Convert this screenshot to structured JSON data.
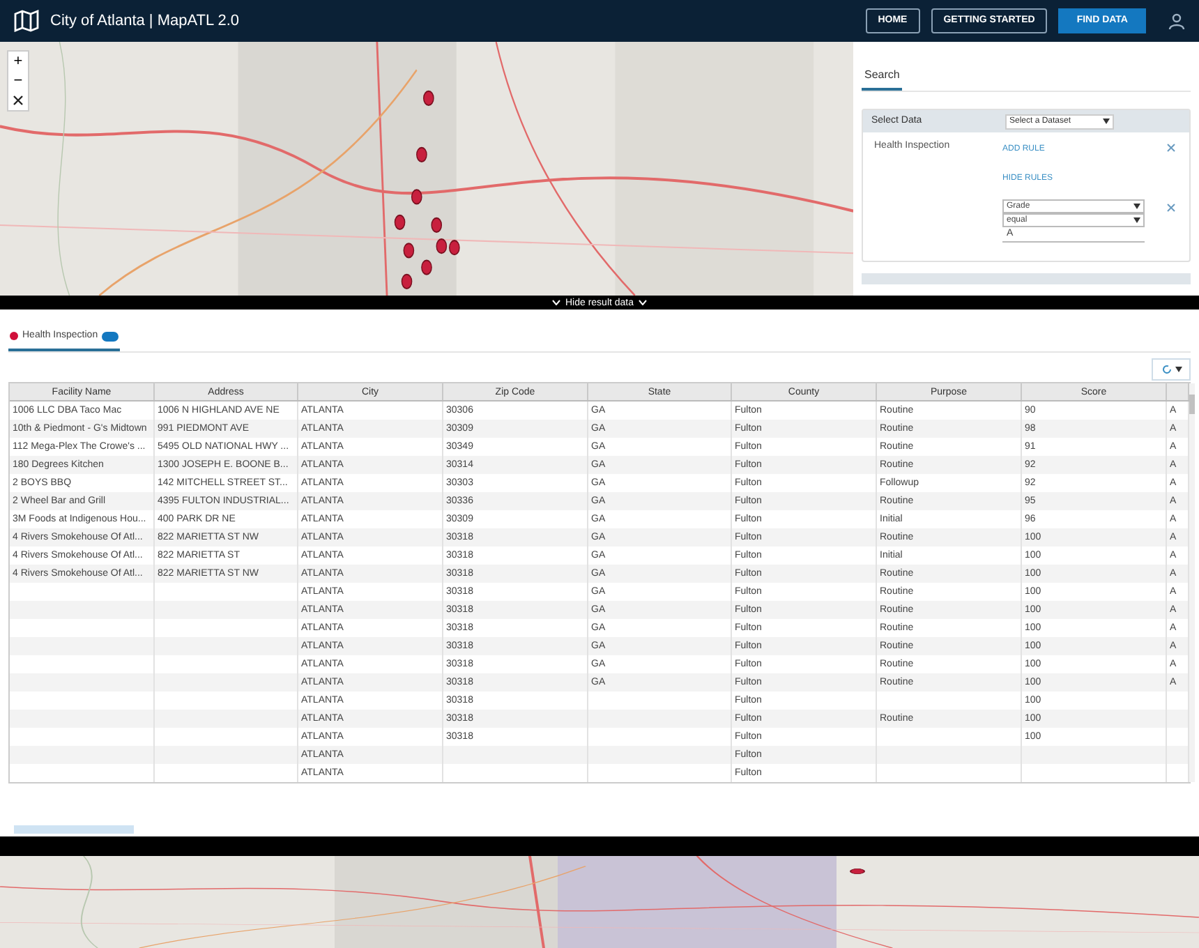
{
  "header": {
    "title": "City of Atlanta | MapATL 2.0",
    "buttons": [
      {
        "label": "HOME",
        "kind": "outline"
      },
      {
        "label": "GETTING STARTED",
        "kind": "outline"
      },
      {
        "label": "FIND DATA",
        "kind": "primary"
      }
    ]
  },
  "map_controls": {
    "zoom_in": "+",
    "zoom_out": "−"
  },
  "search_panel": {
    "tabs": [
      {
        "label": "Search",
        "selected": true
      }
    ],
    "select_data_label": "Select Data",
    "dataset_dropdown": "Select a Dataset",
    "dataset_name": "Health Inspection",
    "add_rule": "ADD RULE",
    "hide_rules": "HIDE RULES",
    "rule": {
      "field": "Grade",
      "operator": "equal",
      "value": "A"
    }
  },
  "toggle_bar": {
    "label": "Hide result data"
  },
  "result_tabs": [
    {
      "label": "Health Inspection",
      "selected": true,
      "color": "#d0103a"
    }
  ],
  "table": {
    "columns": [
      "Facility Name",
      "Address",
      "City",
      "Zip Code",
      "State",
      "County",
      "Purpose",
      "Score"
    ],
    "rows": [
      [
        "1006 LLC DBA Taco Mac",
        "1006 N HIGHLAND AVE NE",
        "ATLANTA",
        "30306",
        "GA",
        "Fulton",
        "Routine",
        "90",
        "A"
      ],
      [
        "10th & Piedmont - G's Midtown",
        "991 PIEDMONT AVE",
        "ATLANTA",
        "30309",
        "GA",
        "Fulton",
        "Routine",
        "98",
        "A"
      ],
      [
        "112 Mega-Plex The Crowe's ...",
        "5495 OLD NATIONAL HWY ...",
        "ATLANTA",
        "30349",
        "GA",
        "Fulton",
        "Routine",
        "91",
        "A"
      ],
      [
        "180 Degrees Kitchen",
        "1300 JOSEPH E. BOONE B...",
        "ATLANTA",
        "30314",
        "GA",
        "Fulton",
        "Routine",
        "92",
        "A"
      ],
      [
        "2 BOYS BBQ",
        "142 MITCHELL STREET ST...",
        "ATLANTA",
        "30303",
        "GA",
        "Fulton",
        "Followup",
        "92",
        "A"
      ],
      [
        "2 Wheel Bar and Grill",
        "4395 FULTON INDUSTRIAL...",
        "ATLANTA",
        "30336",
        "GA",
        "Fulton",
        "Routine",
        "95",
        "A"
      ],
      [
        "3M Foods at Indigenous Hou...",
        "400 PARK DR NE",
        "ATLANTA",
        "30309",
        "GA",
        "Fulton",
        "Initial",
        "96",
        "A"
      ],
      [
        "4 Rivers Smokehouse Of Atl...",
        "822 MARIETTA ST NW",
        "ATLANTA",
        "30318",
        "GA",
        "Fulton",
        "Routine",
        "100",
        "A"
      ],
      [
        "4 Rivers Smokehouse Of Atl...",
        "822 MARIETTA ST",
        "ATLANTA",
        "30318",
        "GA",
        "Fulton",
        "Initial",
        "100",
        "A"
      ],
      [
        "4 Rivers Smokehouse Of Atl...",
        "822 MARIETTA ST NW",
        "ATLANTA",
        "30318",
        "GA",
        "Fulton",
        "Routine",
        "100",
        "A"
      ],
      [
        null,
        null,
        "ATLANTA",
        "30318",
        "GA",
        "Fulton",
        "Routine",
        "100",
        "A"
      ],
      [
        null,
        null,
        "ATLANTA",
        "30318",
        "GA",
        "Fulton",
        "Routine",
        "100",
        "A"
      ],
      [
        null,
        null,
        "ATLANTA",
        "30318",
        "GA",
        "Fulton",
        "Routine",
        "100",
        "A"
      ],
      [
        null,
        null,
        "ATLANTA",
        "30318",
        "GA",
        "Fulton",
        "Routine",
        "100",
        "A"
      ],
      [
        null,
        null,
        "ATLANTA",
        "30318",
        "GA",
        "Fulton",
        "Routine",
        "100",
        "A"
      ],
      [
        null,
        null,
        "ATLANTA",
        "30318",
        "GA",
        "Fulton",
        "Routine",
        "100",
        "A"
      ],
      [
        null,
        null,
        "ATLANTA",
        "30318",
        null,
        "Fulton",
        null,
        "100",
        null
      ],
      [
        null,
        null,
        "ATLANTA",
        "30318",
        null,
        "Fulton",
        "Routine",
        "100",
        null
      ],
      [
        null,
        null,
        "ATLANTA",
        "30318",
        null,
        "Fulton",
        null,
        "100",
        null
      ],
      [
        null,
        null,
        "ATLANTA",
        null,
        null,
        "Fulton",
        null,
        null,
        null
      ],
      [
        null,
        null,
        "ATLANTA",
        null,
        null,
        "Fulton",
        null,
        null,
        null
      ]
    ]
  }
}
